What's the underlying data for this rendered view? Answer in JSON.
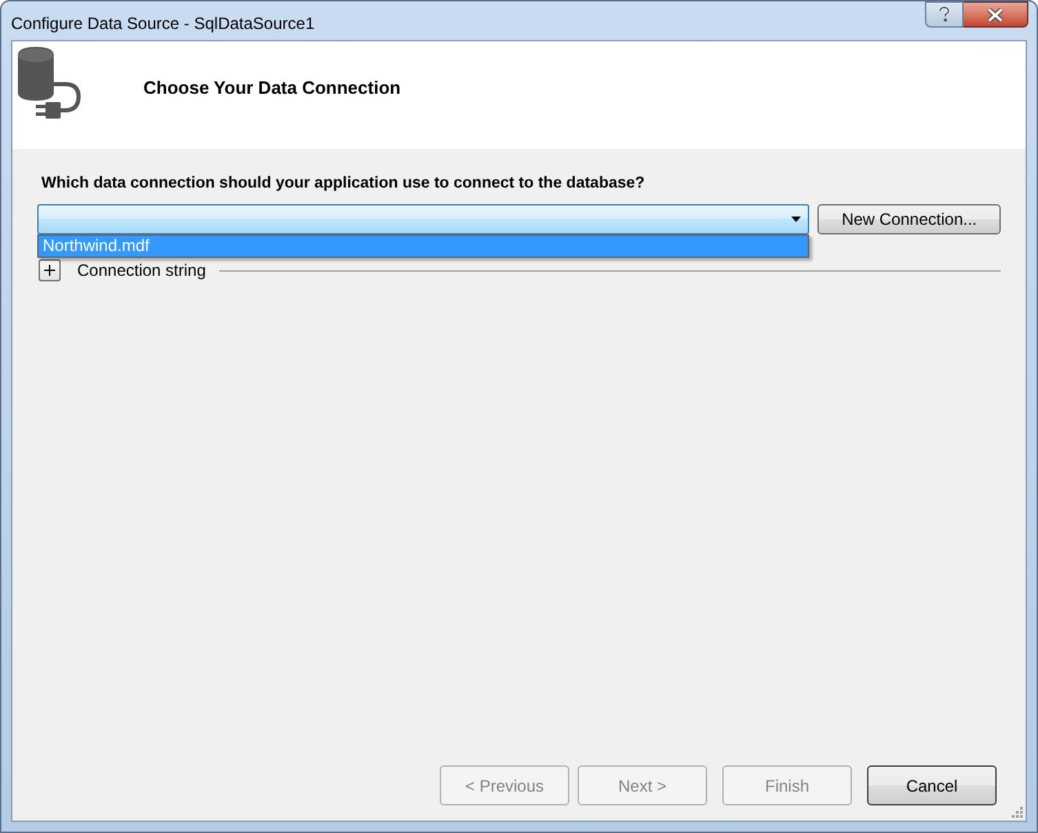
{
  "window": {
    "title": "Configure Data Source - SqlDataSource1"
  },
  "header": {
    "title": "Choose Your Data Connection"
  },
  "connection": {
    "label": "Which data connection should your application use to connect to the database?",
    "dropdown": {
      "expanded": true,
      "options": [
        {
          "label": "Northwind.mdf",
          "selected": true
        }
      ]
    },
    "new_button": "New Connection..."
  },
  "connection_string": {
    "label": "Connection string",
    "expanded": false
  },
  "buttons": [
    {
      "label": "< Previous",
      "disabled": true,
      "default": false
    },
    {
      "label": "Next >",
      "disabled": true,
      "default": false
    },
    {
      "label": "Finish",
      "disabled": true,
      "default": false
    },
    {
      "label": "Cancel",
      "disabled": false,
      "default": true
    }
  ]
}
